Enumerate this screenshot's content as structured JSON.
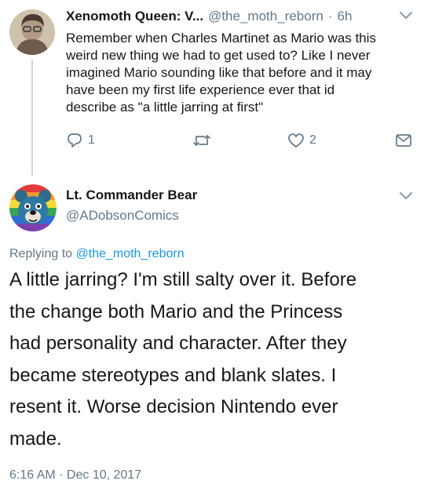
{
  "tweet1": {
    "display_name": "Xenomoth Queen: V...",
    "handle": "@the_moth_reborn",
    "separator": "·",
    "time": "6h",
    "text_lines": [
      "Remember when Charles Martinet as Mario was this",
      "weird new thing we had to get used to? Like I never",
      "imagined Mario sounding like that before and it may",
      "have been my first life experience ever that id",
      "describe as \"a little jarring at first\""
    ],
    "reply_count": "1",
    "retweet_count": "",
    "like_count": "2"
  },
  "tweet2": {
    "display_name": "Lt. Commander Bear",
    "handle": "@ADobsonComics",
    "replying_prefix": "Replying to",
    "replying_handle": "@the_moth_reborn",
    "text_lines": [
      "A little jarring? I'm still salty over it. Before",
      "the change both Mario and the Princess",
      "had personality and character. After they",
      "became stereotypes and blank slates. I",
      "resent it. Worse decision Nintendo ever",
      "made."
    ],
    "timestamp": "6:16 AM · Dec 10, 2017"
  },
  "colors": {
    "text": "#14171a",
    "secondary": "#657786",
    "link": "#1b95e0",
    "divider": "#ccd6dd"
  },
  "icons": [
    "chevron-down-icon",
    "reply-icon",
    "retweet-icon",
    "like-icon",
    "dm-icon"
  ]
}
